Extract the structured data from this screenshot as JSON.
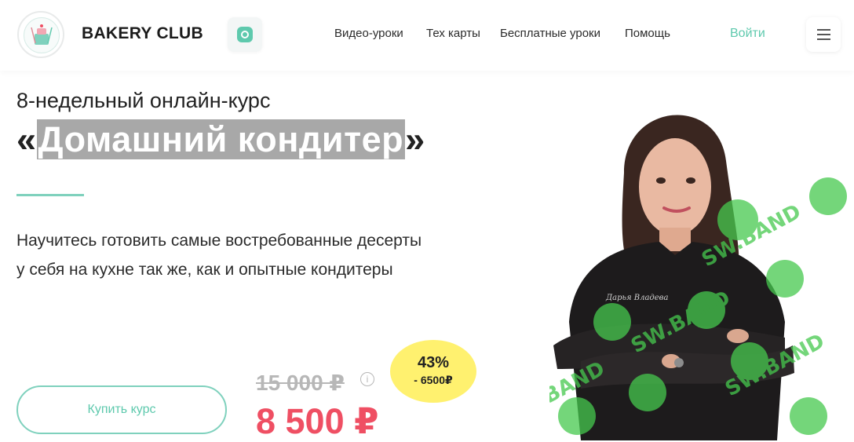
{
  "header": {
    "brand": "BAKERY CLUB",
    "logo_text": "BAKERY CLUB",
    "nav": [
      {
        "label": "Видео-уроки"
      },
      {
        "label": "Тех карты"
      },
      {
        "label": "Бесплатные уроки"
      },
      {
        "label": "Помощь"
      }
    ],
    "login": "Войти",
    "icons": {
      "instagram": "instagram-icon",
      "menu": "hamburger-menu-icon"
    }
  },
  "hero": {
    "subtitle": "8-недельный онлайн-курс",
    "title_open": "«",
    "title_main": "Домашний кондитер",
    "title_close": "»",
    "description": "Научитесь готовить самые востребованные десерты у себя на кухне так же, как и опытные кондитеры",
    "buy_button": "Купить курс"
  },
  "pricing": {
    "old_price": "15 000 ₽",
    "new_price": "8 500 ₽",
    "discount_percent": "43%",
    "discount_amount": "- 6500₽",
    "info_glyph": "i"
  },
  "image": {
    "jacket_text": "Дарья Владевa",
    "watermark": "SW.BAND"
  },
  "colors": {
    "accent": "#5ec9ad",
    "price": "#ef4f63",
    "badge": "#fff16f"
  }
}
